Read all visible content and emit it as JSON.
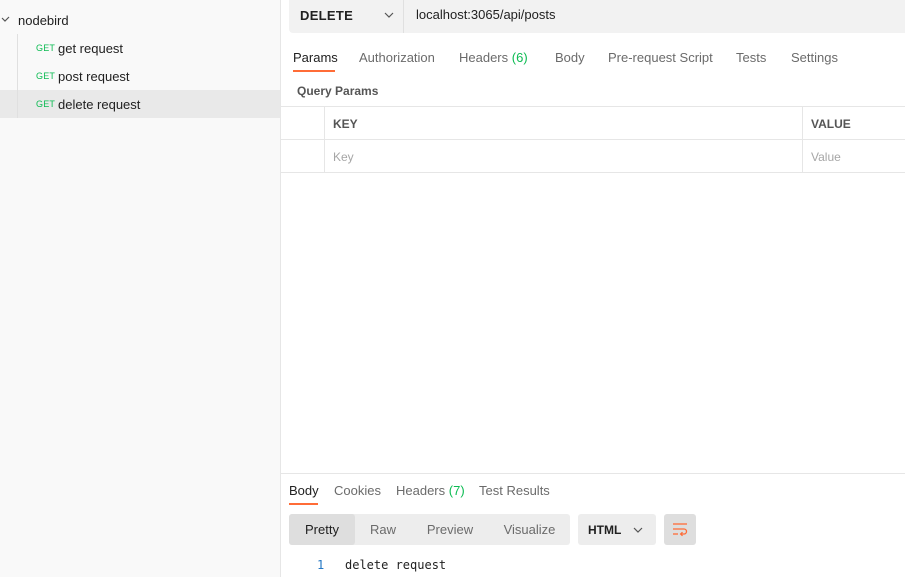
{
  "sidebar": {
    "collection": {
      "name": "nodebird"
    },
    "requests": [
      {
        "method": "GET",
        "name": "get request",
        "active": false
      },
      {
        "method": "GET",
        "name": "post request",
        "active": false
      },
      {
        "method": "GET",
        "name": "delete request",
        "active": true
      }
    ]
  },
  "request": {
    "method": "DELETE",
    "url": "localhost:3065/api/posts"
  },
  "request_tabs": {
    "params": "Params",
    "authorization": "Authorization",
    "headers": "Headers",
    "headers_count": "(6)",
    "body": "Body",
    "prerequest": "Pre-request Script",
    "tests": "Tests",
    "settings": "Settings"
  },
  "params": {
    "section_label": "Query Params",
    "key_header": "KEY",
    "value_header": "VALUE",
    "key_placeholder": "Key",
    "value_placeholder": "Value"
  },
  "response": {
    "tabs": {
      "body": "Body",
      "cookies": "Cookies",
      "headers": "Headers",
      "headers_count": "(7)",
      "test_results": "Test Results"
    },
    "views": {
      "pretty": "Pretty",
      "raw": "Raw",
      "preview": "Preview",
      "visualize": "Visualize"
    },
    "format": "HTML",
    "lines": [
      {
        "number": "1",
        "text": "delete request"
      }
    ]
  },
  "colors": {
    "accent": "#ff6c37",
    "get_method": "#0cbb52",
    "count": "#0cbb52",
    "line_number": "#2477c4"
  }
}
